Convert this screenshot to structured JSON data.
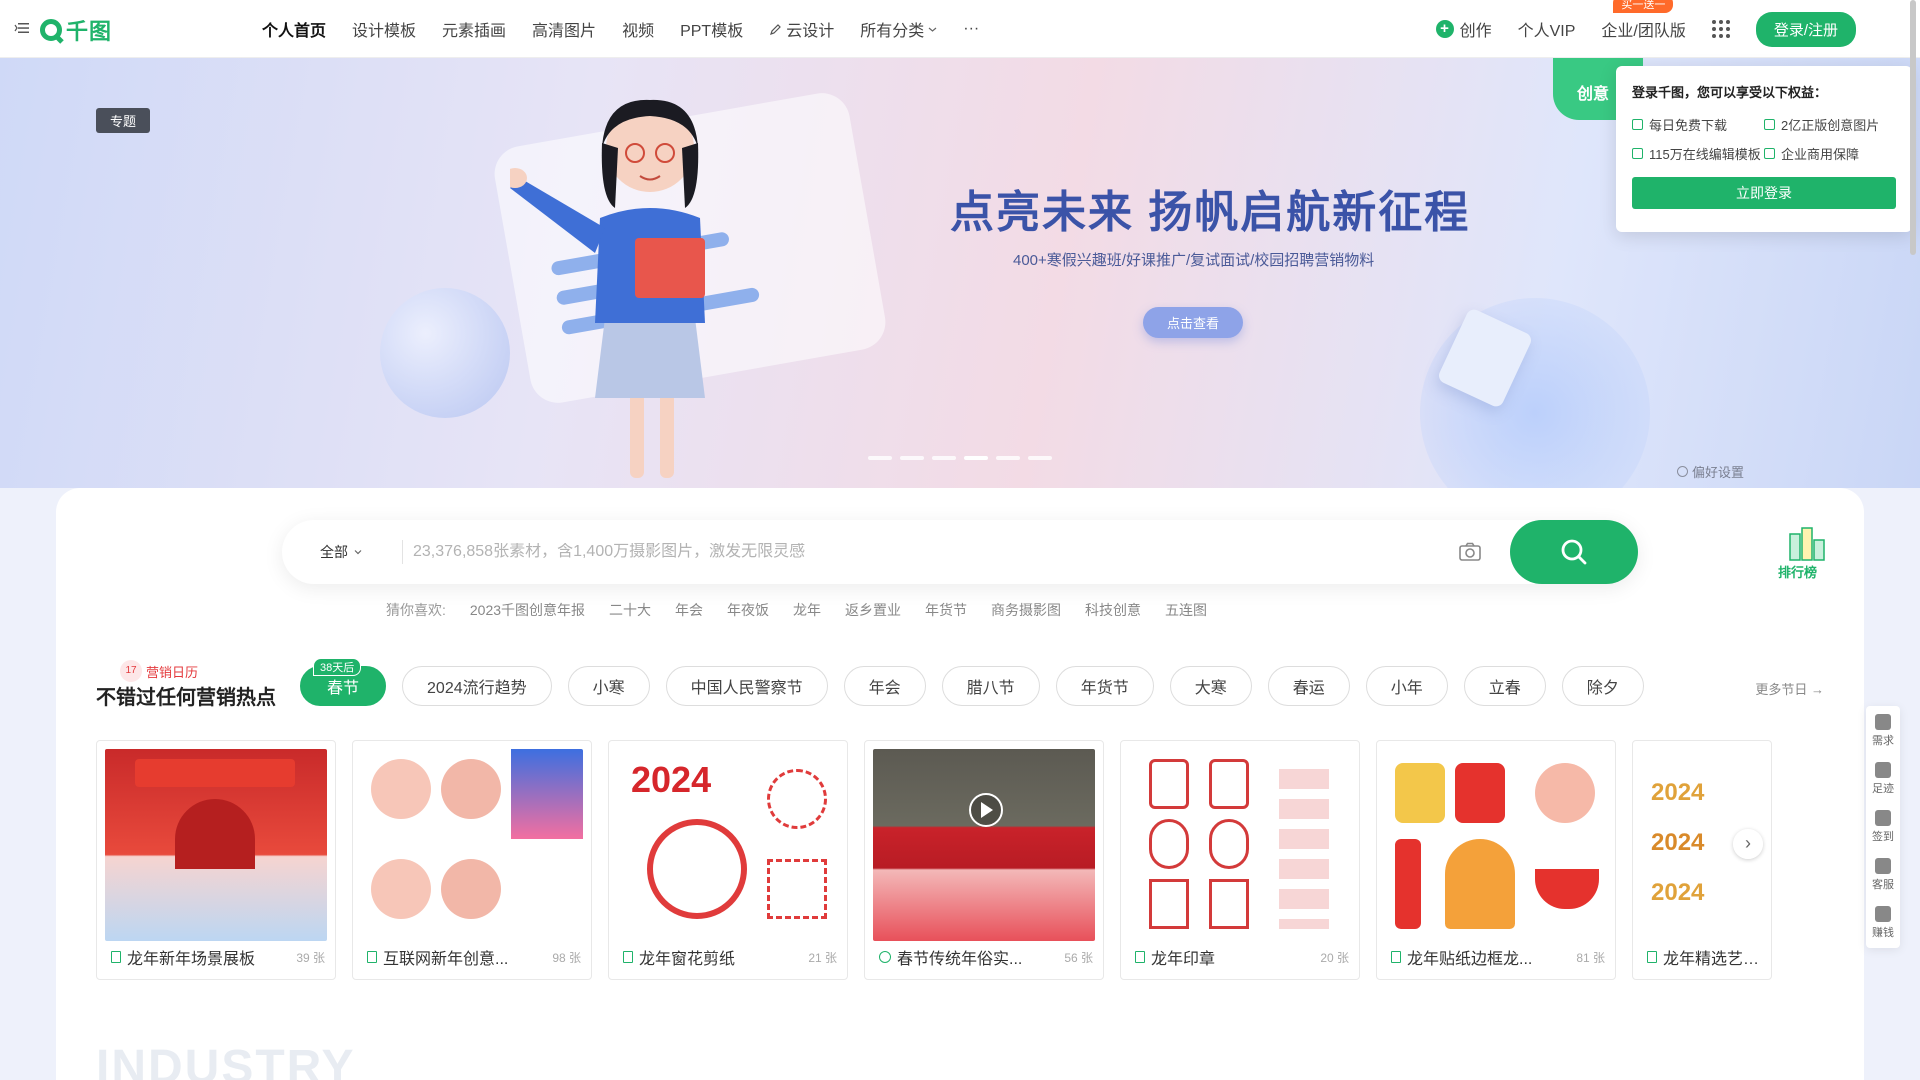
{
  "header": {
    "logo_text": "千图",
    "nav": [
      "个人首页",
      "设计模板",
      "元素插画",
      "高清图片",
      "视频",
      "PPT模板",
      "云设计",
      "所有分类"
    ],
    "more": "···",
    "create": "创作",
    "vip": "个人VIP",
    "team": "企业/团队版",
    "team_badge": "买一送一",
    "login": "登录/注册"
  },
  "hero": {
    "tag": "专题",
    "title": "点亮未来 扬帆启航新征程",
    "subtitle": "400+寒假兴趣班/好课推广/复试面试/校园招聘营销物料",
    "button": "点击查看",
    "creative_tab": "创意",
    "preference": "偏好设置",
    "slide_count": 6,
    "active_slide": 4
  },
  "login_popup": {
    "title": "登录千图，您可以享受以下权益：",
    "benefits": [
      "每日免费下载",
      "2亿正版创意图片",
      "115万在线编辑模板",
      "企业商用保障"
    ],
    "button": "立即登录"
  },
  "search": {
    "category": "全部",
    "placeholder": "23,376,858张素材，含1,400万摄影图片，激发无限灵感",
    "hot_label": "猜你喜欢:",
    "hot_words": [
      "2023千图创意年报",
      "二十大",
      "年会",
      "年夜饭",
      "龙年",
      "返乡置业",
      "年货节",
      "商务摄影图",
      "科技创意",
      "五连图"
    ],
    "ranking": "排行榜"
  },
  "calendar": {
    "label": "营销日历",
    "title": "不错过任何营销热点",
    "active_badge": "38天后",
    "chips": [
      "春节",
      "2024流行趋势",
      "小寒",
      "中国人民警察节",
      "年会",
      "腊八节",
      "年货节",
      "大寒",
      "春运",
      "小年",
      "立春",
      "除夕"
    ],
    "more": "更多节日 →"
  },
  "cards": [
    {
      "title": "龙年新年场景展板",
      "count": "39 张"
    },
    {
      "title": "互联网新年创意...",
      "count": "98 张"
    },
    {
      "title": "龙年窗花剪纸",
      "count": "21 张"
    },
    {
      "title": "春节传统年俗实...",
      "count": "56 张"
    },
    {
      "title": "龙年印章",
      "count": "20 张"
    },
    {
      "title": "龙年贴纸边框龙...",
      "count": "81 张"
    },
    {
      "title": "龙年精选艺术字",
      "count": ""
    }
  ],
  "industry_text": "INDUSTRY",
  "float_bar": [
    "需求",
    "足迹",
    "签到",
    "客服",
    "赚钱"
  ],
  "colors": {
    "brand": "#1fb36a",
    "hero_title": "#3b53a8",
    "calendar_red": "#e4393c"
  }
}
